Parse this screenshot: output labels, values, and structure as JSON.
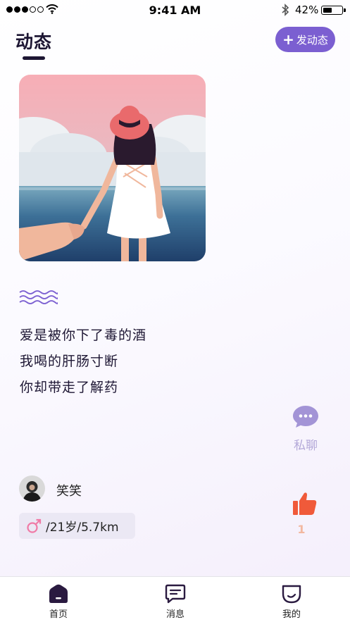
{
  "status_bar": {
    "time": "9:41 AM",
    "battery": "42%",
    "icons": [
      "signal-dots-icon",
      "wifi-icon",
      "bluetooth-icon",
      "battery-icon"
    ]
  },
  "header": {
    "title": "动态",
    "post_button": "发动态"
  },
  "post": {
    "lines": [
      "爱是被你下了毒的酒",
      "我喝的肝肠寸断",
      "你却带走了解药"
    ]
  },
  "actions": {
    "chat_label": "私聊",
    "like_count": "1"
  },
  "user": {
    "name": "笑笑",
    "info": "/21岁/5.7km"
  },
  "tabs": [
    {
      "label": "首页",
      "icon": "home-icon"
    },
    {
      "label": "消息",
      "icon": "message-icon"
    },
    {
      "label": "我的",
      "icon": "profile-icon"
    }
  ],
  "colors": {
    "accent": "#7b5fd1",
    "title": "#1d1633",
    "like": "#f05a3a",
    "chat": "#a394d6"
  }
}
